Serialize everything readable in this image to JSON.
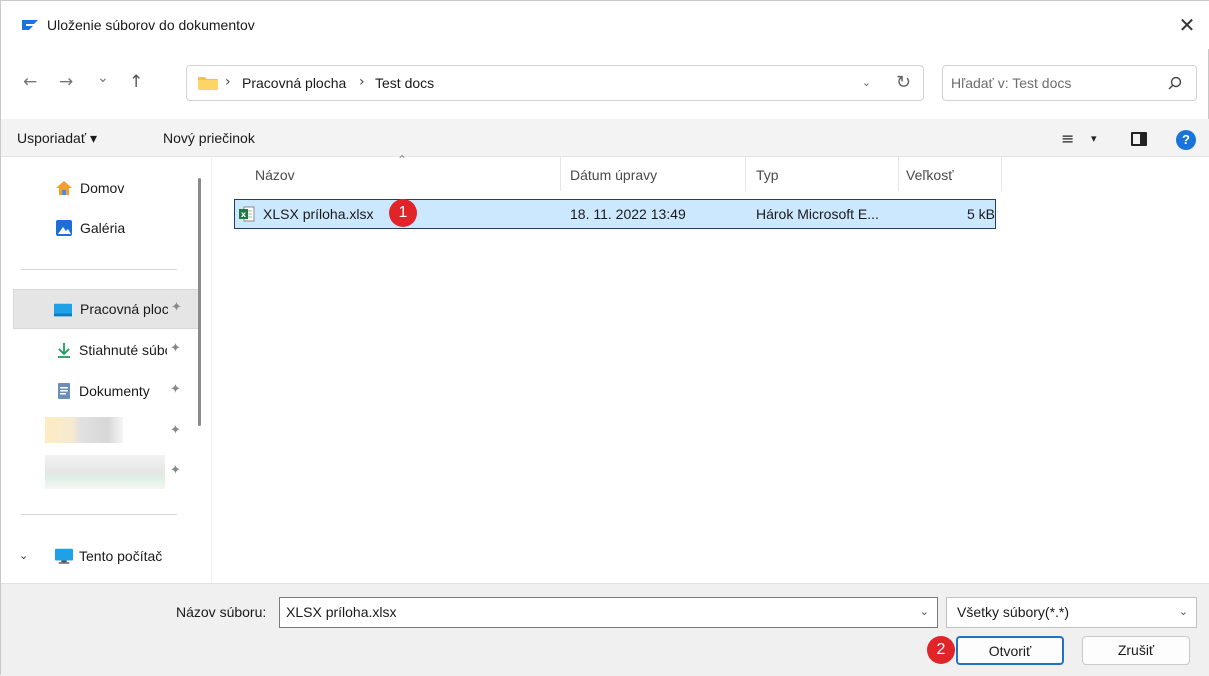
{
  "window": {
    "title": "Uloženie súborov do dokumentov",
    "close_glyph": "✕"
  },
  "nav": {
    "back_glyph": "←",
    "forward_glyph": "→",
    "recent_glyph": "⌄",
    "up_glyph": "↑",
    "breadcrumbs": [
      "Pracovná plocha",
      "Test docs"
    ],
    "crumb_sep": "›",
    "dropdown_glyph": "⌄",
    "refresh_glyph": "↻"
  },
  "search": {
    "placeholder": "Hľadať v: Test docs"
  },
  "toolbar": {
    "organize_label": "Usporiadať ▾",
    "new_folder_label": "Nový priečinok",
    "view_glyph": "≡",
    "view_dd_glyph": "▾",
    "help_label": "?"
  },
  "sidebar": {
    "items": [
      {
        "label": "Domov",
        "icon": "home-icon"
      },
      {
        "label": "Galéria",
        "icon": "gallery-icon"
      },
      {
        "label": "Pracovná plocha",
        "icon": "desktop-icon",
        "pinned": true,
        "selected": true
      },
      {
        "label": "Stiahnuté súbory",
        "icon": "download-icon",
        "pinned": true
      },
      {
        "label": "Dokumenty",
        "icon": "documents-icon",
        "pinned": true
      },
      {
        "label": "Tento počítač",
        "icon": "computer-icon"
      }
    ],
    "pin_glyph": "📌",
    "expander_glyph": "⌄"
  },
  "columns": [
    "Názov",
    "Dátum úpravy",
    "Typ",
    "Veľkosť"
  ],
  "files": [
    {
      "name": "XLSX príloha.xlsx",
      "modified": "18. 11. 2022 13:49",
      "type": "Hárok Microsoft E...",
      "size": "5 kB",
      "icon": "excel-file-icon"
    }
  ],
  "annotations": [
    "1",
    "2"
  ],
  "bottom": {
    "filename_label": "Názov súboru:",
    "filename_value": "XLSX príloha.xlsx",
    "filetype_value": "Všetky súbory(*.*)",
    "open_label": "Otvoriť",
    "cancel_label": "Zrušiť"
  },
  "colors": {
    "accent": "#1f72c9",
    "selection": "#cce8ff",
    "badge": "#e0242a"
  }
}
